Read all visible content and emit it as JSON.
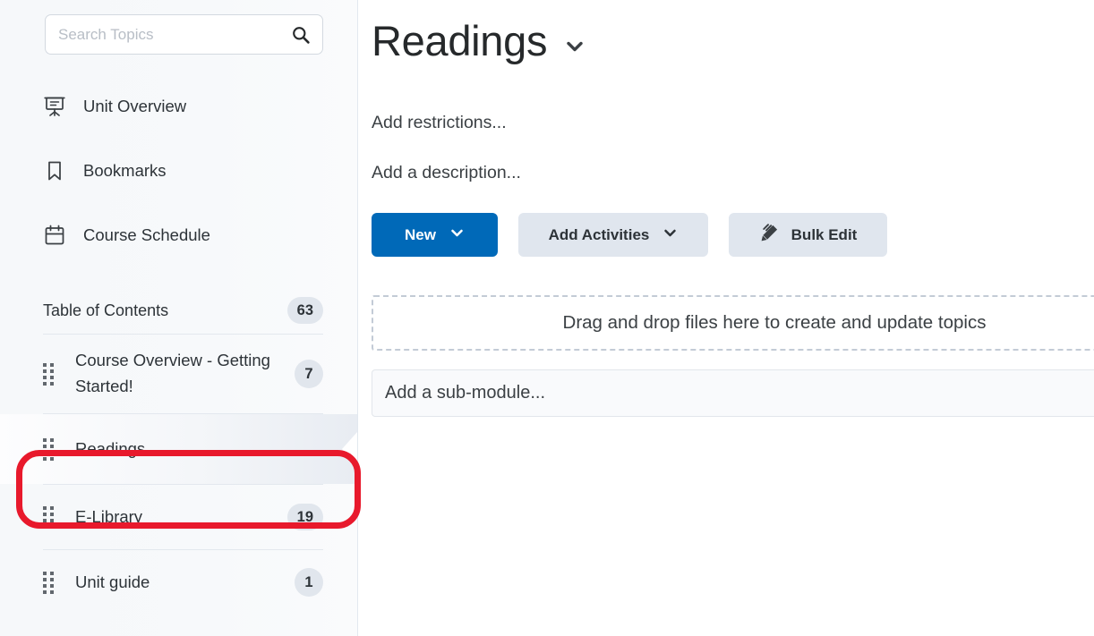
{
  "sidebar": {
    "search": {
      "placeholder": "Search Topics",
      "value": "",
      "icon": "search-icon"
    },
    "nav_items": [
      {
        "label": "Unit Overview",
        "icon": "presentation-board-icon"
      },
      {
        "label": "Bookmarks",
        "icon": "bookmark-icon"
      },
      {
        "label": "Course Schedule",
        "icon": "calendar-icon"
      }
    ],
    "toc": {
      "title": "Table of Contents",
      "count": "63",
      "rows": [
        {
          "label": "Course Overview - Getting Started!",
          "count": "7",
          "selected": false
        },
        {
          "label": "Readings",
          "count": "",
          "selected": true
        },
        {
          "label": "E-Library",
          "count": "19",
          "selected": false
        },
        {
          "label": "Unit guide",
          "count": "1",
          "selected": false
        }
      ]
    },
    "annotation": {
      "shape": "rounded-rectangle",
      "color": "#e8192c",
      "target": "Readings"
    }
  },
  "main": {
    "title": "Readings",
    "title_chevron_icon": "chevron-down-icon",
    "restrictions_link": "Add restrictions...",
    "description_link": "Add a description...",
    "buttons": [
      {
        "label": "New",
        "style": "primary",
        "icon": "chevron-down-icon",
        "icon_position": "right"
      },
      {
        "label": "Add Activities",
        "style": "secondary",
        "icon": "chevron-down-icon",
        "icon_position": "right"
      },
      {
        "label": "Bulk Edit",
        "style": "secondary",
        "icon": "pencil-edit-icon",
        "icon_position": "left"
      }
    ],
    "dropzone_text": "Drag and drop files here to create and update topics",
    "submodule_text": "Add a sub-module..."
  },
  "colors": {
    "accent_blue": "#0069b8",
    "annotation_red": "#e8192c",
    "badge_bg": "#e1e6ed",
    "secondary_btn_bg": "#e0e6ee",
    "sidebar_bg": "#f7f9fb"
  }
}
